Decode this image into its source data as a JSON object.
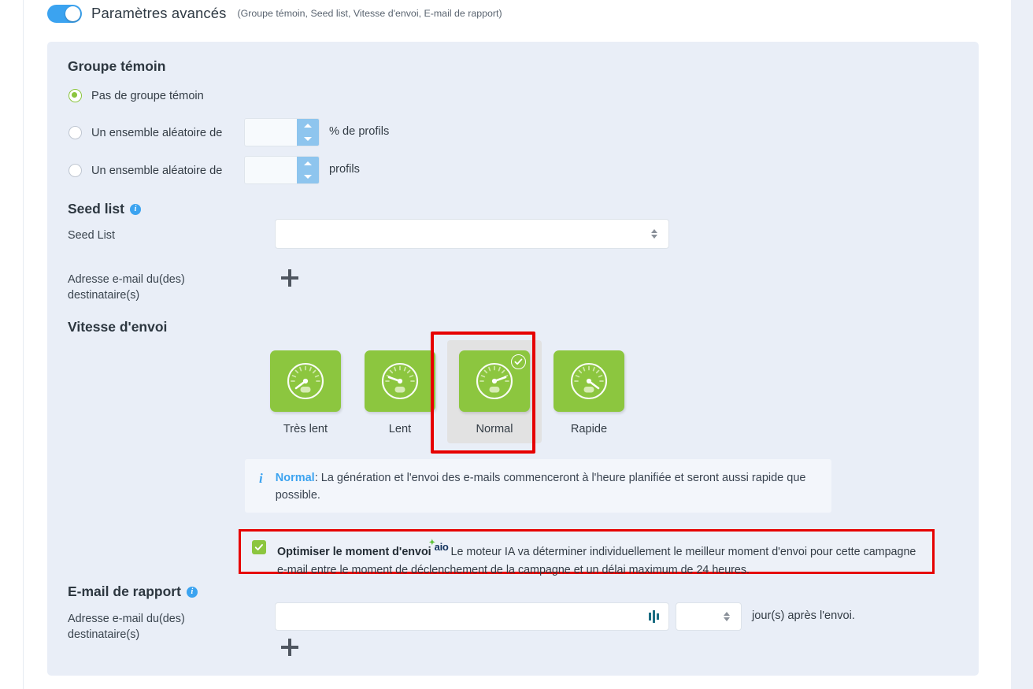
{
  "header": {
    "toggle_label": "Paramètres avancés",
    "toggle_sub": "(Groupe témoin, Seed list, Vitesse d'envoi, E-mail de rapport)",
    "toggle_state": "on",
    "accent_blue": "#3ba3f0"
  },
  "control_group": {
    "title": "Groupe témoin",
    "options": [
      {
        "label": "Pas de groupe témoin",
        "checked": true
      },
      {
        "label": "Un ensemble aléatoire de",
        "checked": false,
        "value": "",
        "unit": "% de profils"
      },
      {
        "label": "Un ensemble aléatoire de",
        "checked": false,
        "value": "",
        "unit": "profils"
      }
    ]
  },
  "seed_list": {
    "title": "Seed list",
    "info_icon": "info-icon",
    "select_label": "Seed List",
    "select_value": "",
    "recipient_label_line1": "Adresse e-mail du(des)",
    "recipient_label_line2": "destinataire(s)",
    "add_label": "+"
  },
  "sending_speed": {
    "title": "Vitesse d'envoi",
    "options": [
      {
        "label": "Très lent",
        "selected": false,
        "icon": "gauge-icon",
        "needle": -50
      },
      {
        "label": "Lent",
        "selected": false,
        "icon": "gauge-icon",
        "needle": -22
      },
      {
        "label": "Normal",
        "selected": true,
        "icon": "gauge-icon",
        "needle": 22
      },
      {
        "label": "Rapide",
        "selected": false,
        "icon": "gauge-icon",
        "needle": 50
      }
    ],
    "tile_color": "#8cc63f",
    "selected_bg": "#e2e2e2",
    "highlight_color": "#e60000",
    "info": {
      "strong": "Normal",
      "text": ": La génération et l'envoi des e-mails commenceront à l'heure planifiée et seront aussi rapide que possible."
    }
  },
  "optimize": {
    "checked": true,
    "label": "Optimiser le moment d'envoi",
    "badge": "aio",
    "description": "Le moteur IA va déterminer individuellement le meilleur moment d'envoi pour cette campagne e-mail entre le moment de déclenchement de la campagne et un délai maximum de 24 heures.",
    "highlight_color": "#e60000"
  },
  "report_email": {
    "title": "E-mail de rapport",
    "info_icon": "info-icon",
    "recipient_label_line1": "Adresse e-mail du(des)",
    "recipient_label_line2": "destinataire(s)",
    "email_value": "",
    "merge_icon": "personalization-icon",
    "days_value": "",
    "days_unit": "jour(s) après l'envoi.",
    "add_label": "+"
  }
}
